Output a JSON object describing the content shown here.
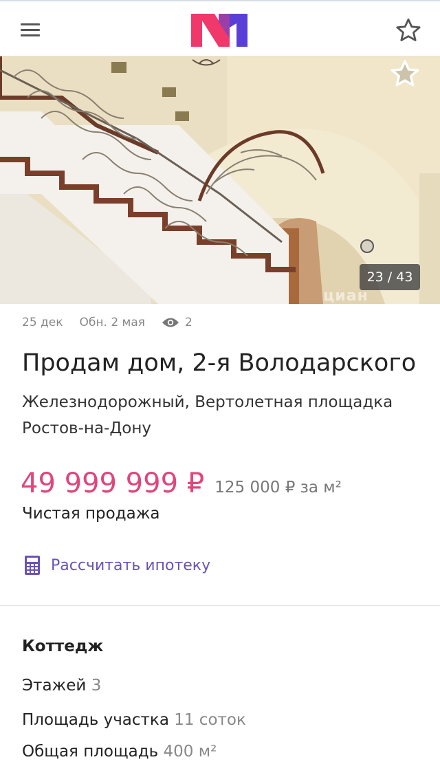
{
  "header": {
    "menu_icon": "hamburger-icon",
    "logo_text": "N1",
    "favorite_icon": "star-outline-icon"
  },
  "gallery": {
    "counter": "23 / 43",
    "watermark": "циан",
    "favorite_icon": "star-outline-icon"
  },
  "meta": {
    "published": "25 дек",
    "updated": "Обн. 2 мая",
    "views": "2",
    "views_icon": "eye-icon"
  },
  "listing": {
    "title": "Продам дом, 2-я Володарского",
    "district": "Железнодорожный, Вертолетная площадка",
    "city": "Ростов-на-Дону",
    "price": "49 999 999 ₽",
    "price_per_m2": "125 000 ₽ за м²",
    "sale_type": "Чистая продажа",
    "mortgage_link": "Рассчитать ипотеку",
    "mortgage_icon": "calculator-icon"
  },
  "details": {
    "section_title": "Коттедж",
    "specs": [
      {
        "label": "Этажей",
        "value": "3"
      },
      {
        "label": "Площадь участка",
        "value": "11 соток"
      },
      {
        "label": "Общая площадь",
        "value": "400 м²"
      }
    ]
  },
  "colors": {
    "price": "#e0457b",
    "link": "#6b52b8",
    "logo_pink": "#f0386b",
    "logo_purple": "#5a3fd6"
  }
}
